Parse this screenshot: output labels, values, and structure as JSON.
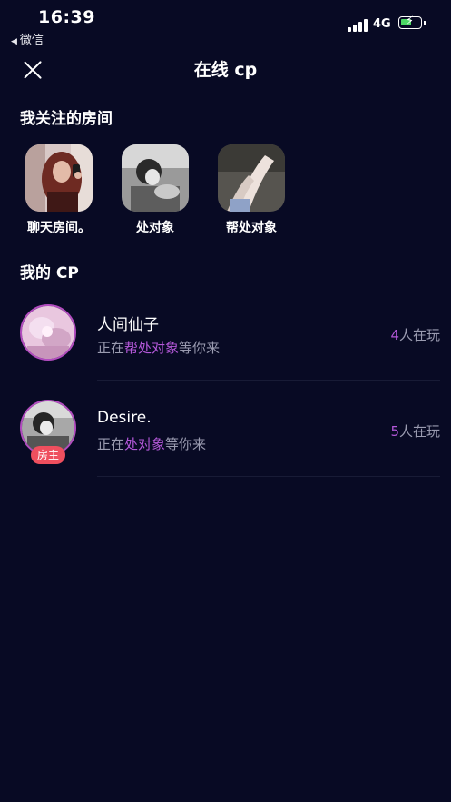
{
  "status_bar": {
    "time": "16:39",
    "back_app": "微信",
    "network": "4G"
  },
  "header": {
    "title": "在线 cp"
  },
  "followed_rooms": {
    "title": "我关注的房间",
    "rooms": [
      {
        "label": "聊天房间。"
      },
      {
        "label": "处对象"
      },
      {
        "label": "帮处对象"
      }
    ]
  },
  "my_cp": {
    "title": "我的 CP",
    "items": [
      {
        "name": "人间仙子",
        "status_prefix": "正在",
        "room": "帮处对象",
        "status_suffix": "等你来",
        "count": "4",
        "count_suffix": "人在玩"
      },
      {
        "name": "Desire.",
        "status_prefix": "正在",
        "room": "处对象",
        "status_suffix": "等你来",
        "count": "5",
        "count_suffix": "人在玩",
        "badge": "房主"
      }
    ]
  },
  "colors": {
    "background": "#080a24",
    "accent": "#b458d9",
    "badge": "#ef4f5e"
  }
}
